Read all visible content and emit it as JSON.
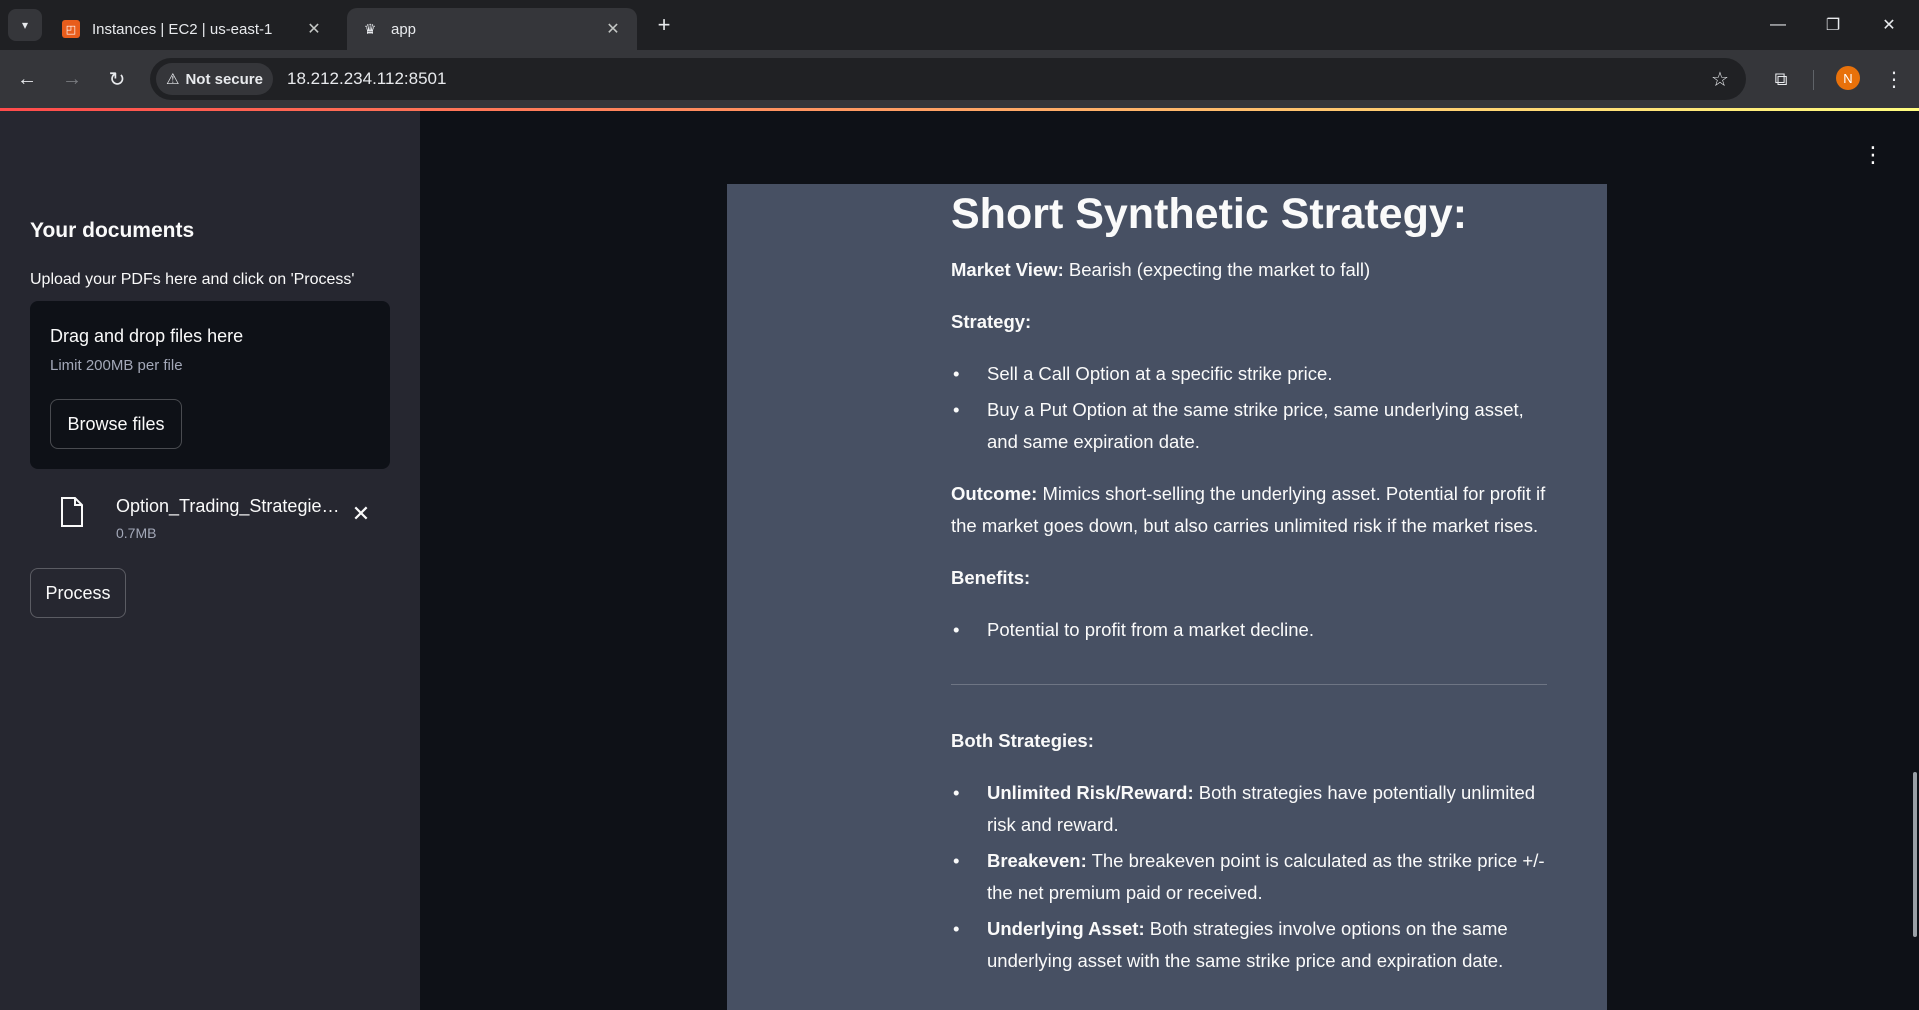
{
  "browser": {
    "tabs": [
      {
        "title": "Instances | EC2 | us-east-1",
        "icon": "aws-ec2-icon",
        "active": false
      },
      {
        "title": "app",
        "icon": "streamlit-crown-icon",
        "active": true
      }
    ],
    "security_label": "Not secure",
    "url": "18.212.234.112:8501",
    "profile_initial": "N",
    "accent_color": "#ff4b4b"
  },
  "sidebar": {
    "title": "Your documents",
    "upload_label": "Upload your PDFs here and click on 'Process'",
    "dropzone_title": "Drag and drop files here",
    "dropzone_limit": "Limit 200MB per file",
    "browse_label": "Browse files",
    "file": {
      "name": "Option_Trading_Strategies.pdf",
      "size": "0.7MB"
    },
    "process_label": "Process"
  },
  "response": {
    "heading": "Short Synthetic Strategy:",
    "market_view_label": "Market View:",
    "market_view_text": " Bearish (expecting the market to fall)",
    "strategy_label": "Strategy:",
    "strategy_items": [
      "Sell a Call Option at a specific strike price.",
      "Buy a Put Option at the same strike price, same underlying asset, and same expiration date."
    ],
    "outcome_label": "Outcome:",
    "outcome_text": " Mimics short-selling the underlying asset. Potential for profit if the market goes down, but also carries unlimited risk if the market rises.",
    "benefits_label": "Benefits:",
    "benefits_items": [
      "Potential to profit from a market decline."
    ],
    "both_label": "Both Strategies:",
    "both_items": [
      {
        "label": "Unlimited Risk/Reward:",
        "text": " Both strategies have potentially unlimited risk and reward."
      },
      {
        "label": "Breakeven:",
        "text": " The breakeven point is calculated as the strike price +/- the net premium paid or received."
      },
      {
        "label": "Underlying Asset:",
        "text": " Both strategies involve options on the same underlying asset with the same strike price and expiration date."
      }
    ]
  }
}
